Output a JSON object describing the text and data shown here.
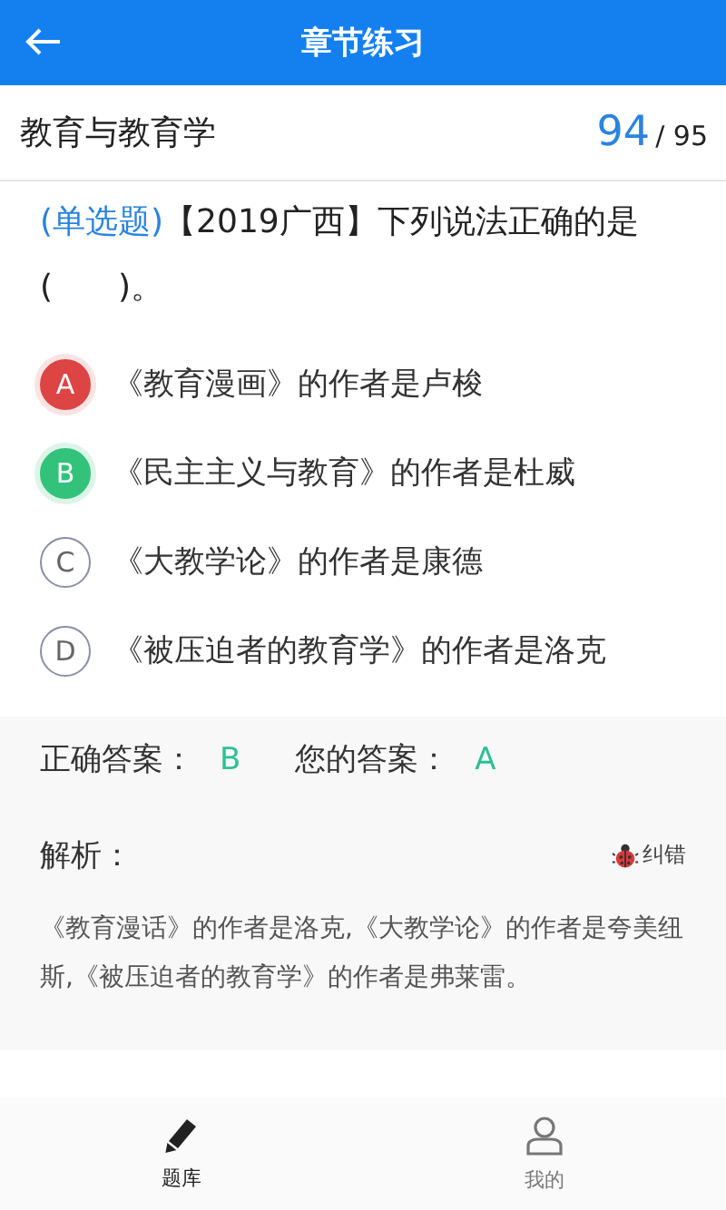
{
  "header": {
    "title": "章节练习"
  },
  "chapter": {
    "title": "教育与教育学",
    "current": "94",
    "total": "/ 95"
  },
  "question": {
    "type_label": "(单选题)",
    "text": "【2019广西】下列说法正确的是(　　)。"
  },
  "options": [
    {
      "letter": "A",
      "text": "《教育漫画》的作者是卢梭",
      "kind": "wrong"
    },
    {
      "letter": "B",
      "text": "《民主主义与教育》的作者是杜威",
      "kind": "correct"
    },
    {
      "letter": "C",
      "text": "《大教学论》的作者是康德",
      "kind": "plain"
    },
    {
      "letter": "D",
      "text": "《被压迫者的教育学》的作者是洛克",
      "kind": "plain"
    }
  ],
  "answers": {
    "correct_label": "正确答案：",
    "correct": "B",
    "yours_label": "您的答案：",
    "yours": "A"
  },
  "analysis": {
    "title": "解析：",
    "report": "纠错",
    "text": "《教育漫话》的作者是洛克,《大教学论》的作者是夸美纽斯,《被压迫者的教育学》的作者是弗莱雷。"
  },
  "nav": [
    {
      "label": "题库",
      "kind": "pencil",
      "selected": true
    },
    {
      "label": "我的",
      "kind": "person",
      "selected": false
    }
  ]
}
